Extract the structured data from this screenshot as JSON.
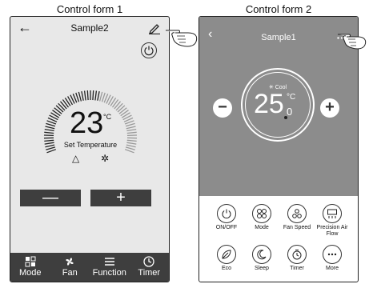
{
  "captions": {
    "form1": "Control form 1",
    "form2": "Control form 2"
  },
  "form1": {
    "title": "Sample2",
    "temperature": "23",
    "unit": "°C",
    "set_label": "Set Temperature",
    "icons": [
      "triangle-icon",
      "snowflake-icon"
    ],
    "minus_label": "—",
    "plus_label": "+",
    "bottom_bar": [
      {
        "label": "Mode",
        "icon": "mode-icon"
      },
      {
        "label": "Fan",
        "icon": "fan-icon"
      },
      {
        "label": "Function",
        "icon": "menu-icon"
      },
      {
        "label": "Timer",
        "icon": "clock-icon"
      }
    ]
  },
  "form2": {
    "title": "Sample1",
    "mode": "✳ Cool",
    "temperature": "25",
    "unit": "°C",
    "decimal": "0",
    "minus_label": "−",
    "plus_label": "+",
    "controls": [
      {
        "label": "ON/OFF",
        "icon": "power-icon"
      },
      {
        "label": "Mode",
        "icon": "mode-icon"
      },
      {
        "label": "Fan Speed",
        "icon": "fan-icon"
      },
      {
        "label": "Precision Air Flow",
        "icon": "airflow-icon"
      },
      {
        "label": "Eco",
        "icon": "leaf-icon"
      },
      {
        "label": "Sleep",
        "icon": "moon-icon"
      },
      {
        "label": "Timer",
        "icon": "stopwatch-icon"
      },
      {
        "label": "More",
        "icon": "more-icon"
      }
    ]
  },
  "colors": {
    "dark_bar": "#3e3e3e",
    "hero_gray": "#8c8c8c",
    "screen_bg": "#e8e8e8"
  }
}
